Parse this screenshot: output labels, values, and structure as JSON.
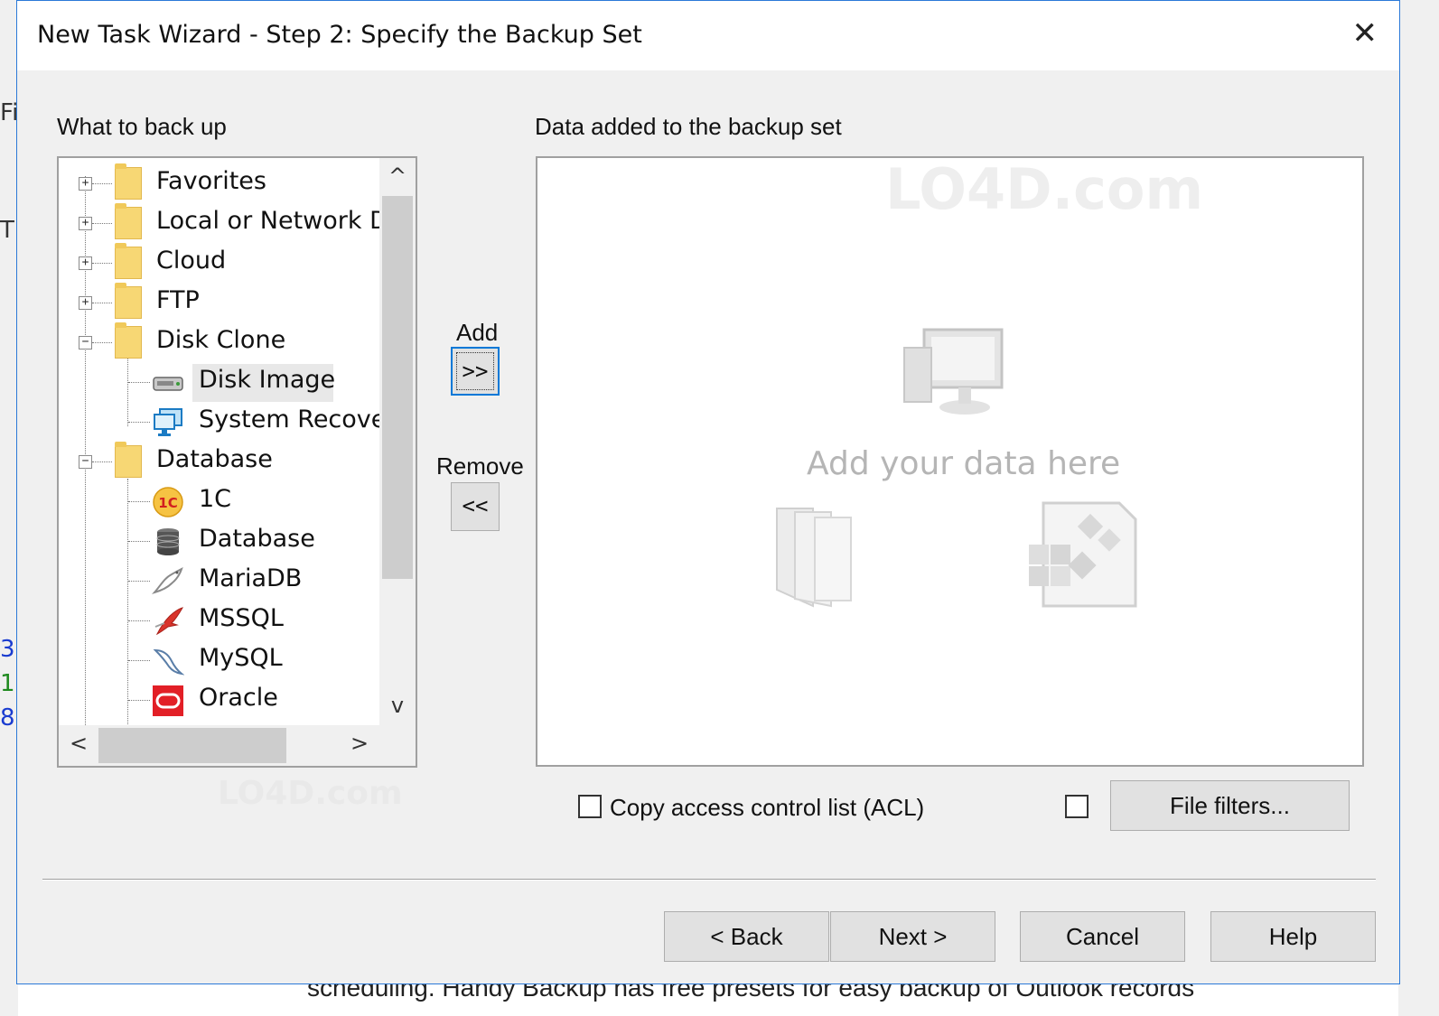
{
  "window": {
    "title": "New Task Wizard - Step 2: Specify the Backup Set",
    "close_glyph": "✕"
  },
  "left_panel": {
    "heading": "What to back up",
    "tree": [
      {
        "label": "Favorites",
        "expander": "+"
      },
      {
        "label": "Local or Network D",
        "expander": "+"
      },
      {
        "label": "Cloud",
        "expander": "+"
      },
      {
        "label": "FTP",
        "expander": "+"
      },
      {
        "label": "Disk Clone",
        "expander": "−"
      },
      {
        "label": "Disk Image",
        "selected": true
      },
      {
        "label": "System Recover"
      },
      {
        "label": "Database",
        "expander": "−"
      },
      {
        "label": "1C"
      },
      {
        "label": "Database"
      },
      {
        "label": "MariaDB"
      },
      {
        "label": "MSSQL"
      },
      {
        "label": "MySQL"
      },
      {
        "label": "Oracle"
      }
    ],
    "scroll_up": "^",
    "scroll_down": "v",
    "scroll_left": "<",
    "scroll_right": ">"
  },
  "middle": {
    "add_label": "Add",
    "add_button": ">>",
    "remove_label": "Remove",
    "remove_button": "<<"
  },
  "right_panel": {
    "heading": "Data added to the backup set",
    "hint": "Add your data here"
  },
  "options": {
    "acl_label": "Copy access control list (ACL)",
    "file_filters": "File filters..."
  },
  "footer": {
    "back": "< Back",
    "next": "Next >",
    "cancel": "Cancel",
    "help": "Help"
  },
  "background": {
    "bottom_text": "scheduling. Handy Backup has free presets for easy backup of Outlook records"
  },
  "watermarks": {
    "brand": "LO4D.com"
  }
}
